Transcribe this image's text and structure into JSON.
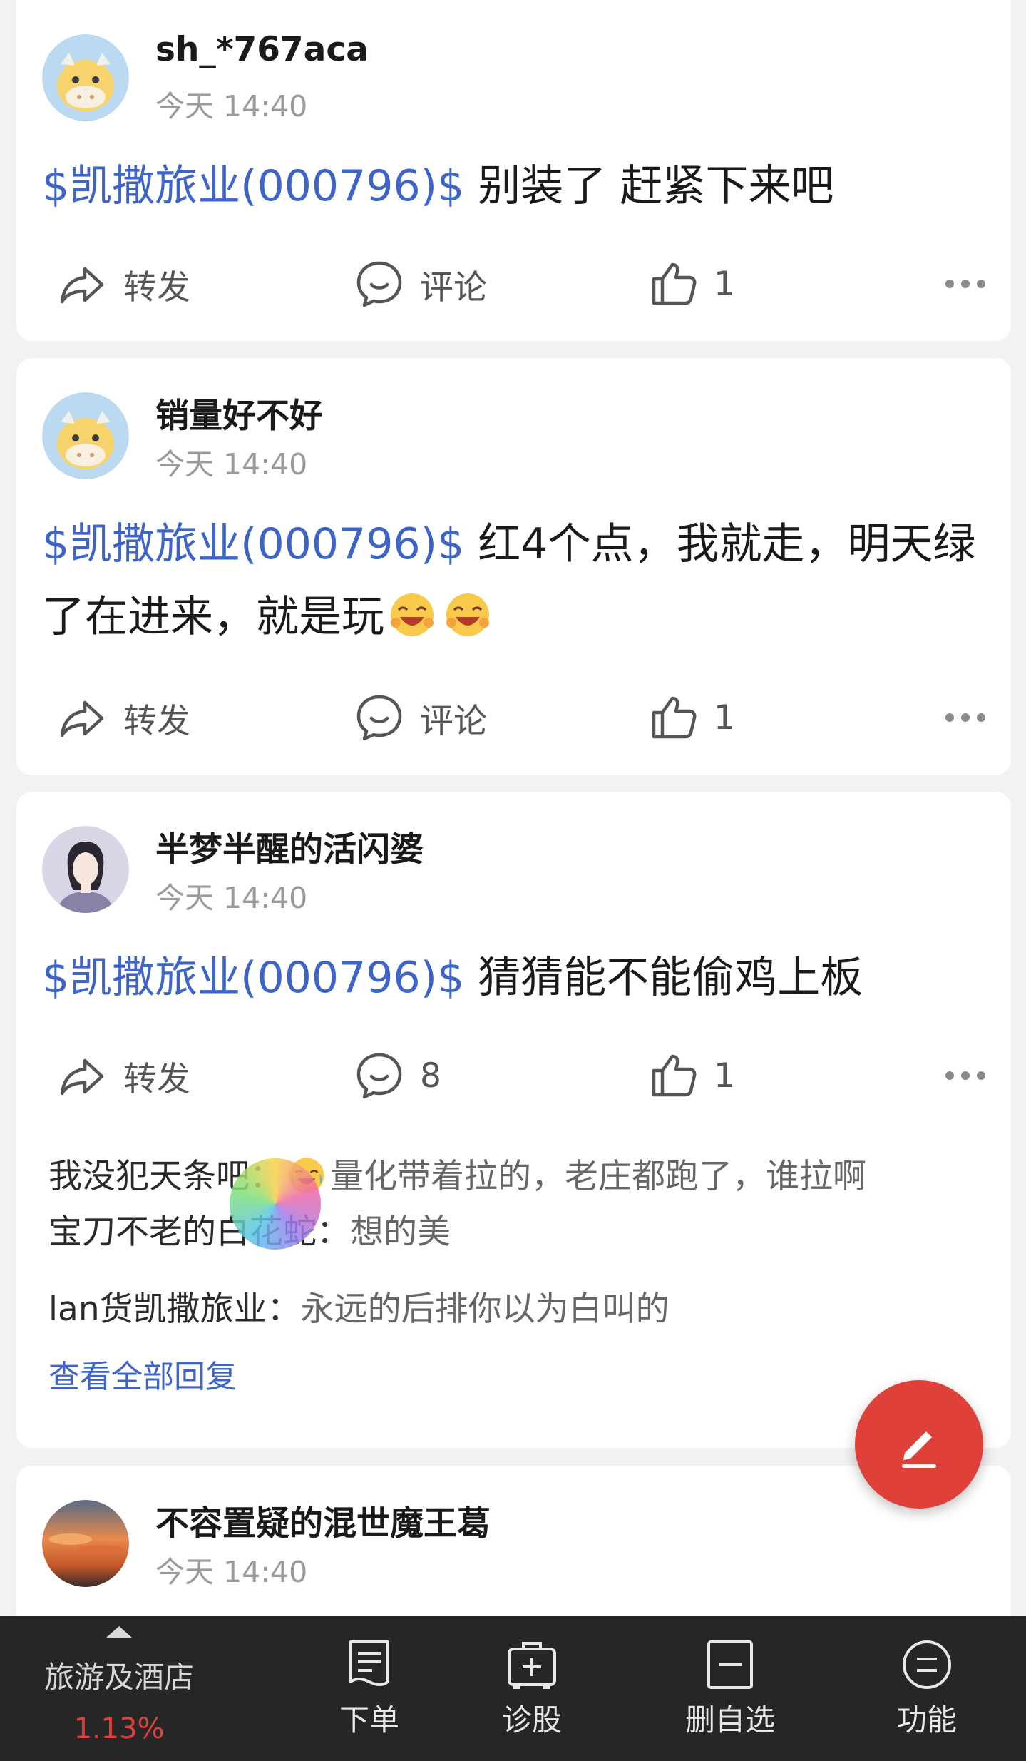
{
  "posts": [
    {
      "username": "sh_*767aca",
      "time": "今天 14:40",
      "stock": "$凯撒旅业(000796)$",
      "text": " 别装了 赶紧下来吧",
      "repost_label": "转发",
      "comment_label": "评论",
      "like_count": "1",
      "avatar": "cow-avatar"
    },
    {
      "username": "销量好不好",
      "time": "今天 14:40",
      "stock": "$凯撒旅业(000796)$",
      "text": " 红4个点，我就走，明天绿了在进来，就是玩",
      "repost_label": "转发",
      "comment_label": "评论",
      "like_count": "1",
      "avatar": "cow-avatar"
    },
    {
      "username": "半梦半醒的活闪婆",
      "time": "今天 14:40",
      "stock": "$凯撒旅业(000796)$",
      "text": " 猜猜能不能偷鸡上板",
      "repost_label": "转发",
      "comment_count": "8",
      "like_count": "1",
      "avatar": "woman-avatar",
      "replies": [
        {
          "user": "我没犯天条吧：",
          "text": "量化带着拉的，老庄都跑了，谁拉啊"
        },
        {
          "user": "宝刀不老的白花蛇：",
          "text": "想的美"
        },
        {
          "user": "lan货凯撒旅业：",
          "text": "永远的后排你以为白叫的"
        }
      ],
      "view_all": "查看全部回复"
    },
    {
      "username": "不容置疑的混世魔王葛",
      "time": "今天 14:40",
      "avatar": "sunset-avatar"
    }
  ],
  "bottom_bar": {
    "sector_name": "旅游及酒店",
    "sector_change": "1.13%",
    "tabs": [
      {
        "label": "下单",
        "icon": "order-icon"
      },
      {
        "label": "诊股",
        "icon": "diagnose-icon"
      },
      {
        "label": "删自选",
        "icon": "remove-watchlist-icon"
      },
      {
        "label": "功能",
        "icon": "menu-icon"
      }
    ]
  },
  "colors": {
    "stock_link": "#3e64c8",
    "fab": "#e0403a",
    "bottom_bar": "#262626"
  }
}
